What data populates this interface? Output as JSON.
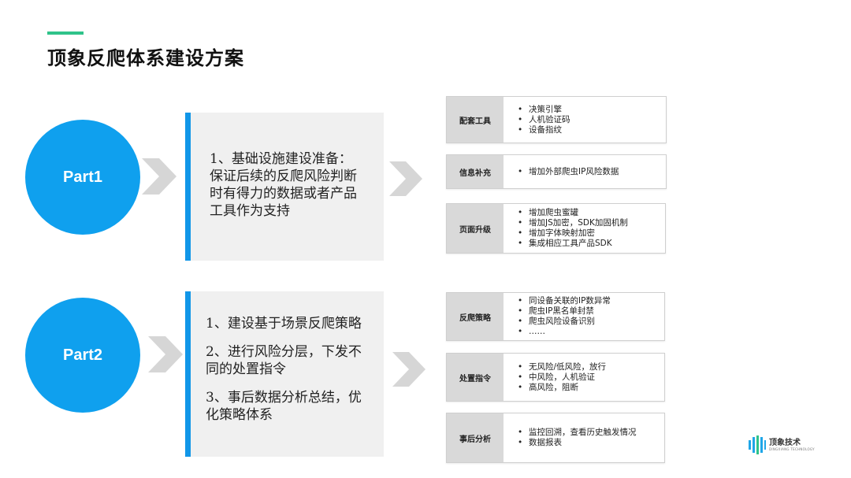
{
  "title": "顶象反爬体系建设方案",
  "colors": {
    "accent_line": "#2fc38a",
    "circle": "#0fa0ee",
    "bar": "#1196e8",
    "box_bg": "#f0f0f0",
    "label_bg": "#d9d9d9",
    "chevron": "#d6d6d6"
  },
  "part1": {
    "label": "Part1",
    "text_lines": [
      "1、基础设施建设准备：",
      "保证后续的反爬风险判断",
      "时有得力的数据或者产品",
      "工具作为支持"
    ]
  },
  "part2": {
    "label": "Part2",
    "items": [
      {
        "lines": [
          "1、建设基于场景反爬策略"
        ]
      },
      {
        "lines": [
          "2、进行风险分层，下发不",
          "同的处置指令"
        ]
      },
      {
        "lines": [
          "3、事后数据分析总结，优",
          "化策略体系"
        ]
      }
    ]
  },
  "cards": [
    {
      "label": "配套工具",
      "items": [
        "决策引擎",
        "人机验证码",
        "设备指纹"
      ]
    },
    {
      "label": "信息补充",
      "items": [
        "增加外部爬虫IP风险数据"
      ]
    },
    {
      "label": "页面升级",
      "items": [
        "增加爬虫蜜罐",
        "增加JS加密，SDK加固机制",
        "增加字体映射加密",
        "集成相应工具产品SDK"
      ]
    },
    {
      "label": "反爬策略",
      "items": [
        "同设备关联的IP数异常",
        "爬虫IP黑名单封禁",
        "爬虫风险设备识别",
        "……"
      ]
    },
    {
      "label": "处置指令",
      "items": [
        "无风险/低风险，放行",
        "中风险，人机验证",
        "高风险，阻断"
      ]
    },
    {
      "label": "事后分析",
      "items": [
        "监控回溯，查看历史触发情况",
        "数据报表"
      ]
    }
  ],
  "brand": {
    "name": "顶象技术",
    "sub": "DINGXIANG TECHNOLOGY",
    "icon": "brand-bars-icon"
  }
}
